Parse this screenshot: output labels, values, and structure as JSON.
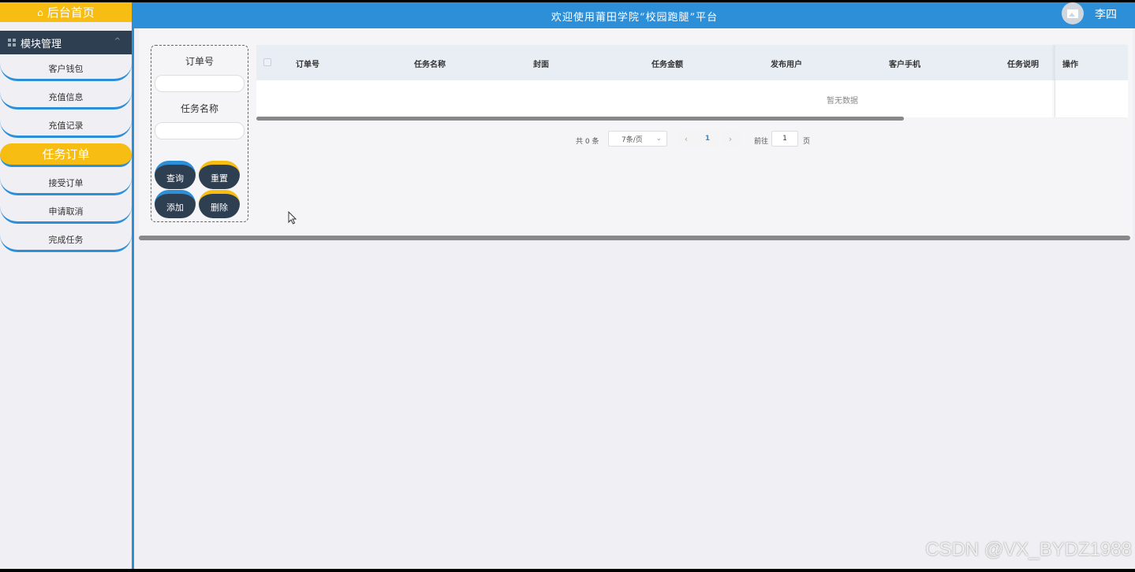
{
  "sidebar": {
    "home_label": "后台首页",
    "module_label": "模块管理",
    "items": [
      {
        "label": "客户钱包"
      },
      {
        "label": "充值信息"
      },
      {
        "label": "充值记录"
      },
      {
        "label": "任务订单"
      },
      {
        "label": "接受订单"
      },
      {
        "label": "申请取消"
      },
      {
        "label": "完成任务"
      }
    ],
    "active_index": 3
  },
  "header": {
    "title": "欢迎使用莆田学院“校园跑腿”平台",
    "username": "李四"
  },
  "search": {
    "order_label": "订单号",
    "task_label": "任务名称",
    "buttons": {
      "query": "查询",
      "reset": "重置",
      "add": "添加",
      "delete": "删除"
    }
  },
  "table": {
    "columns": [
      "订单号",
      "任务名称",
      "封面",
      "任务金额",
      "发布用户",
      "客户手机",
      "任务说明",
      "操作"
    ],
    "empty_text": "暂无数据"
  },
  "pagination": {
    "total_text": "共 0 条",
    "page_size": "7条/页",
    "current_page": "1",
    "goto_label": "前往",
    "goto_value": "1",
    "page_unit": "页"
  },
  "watermark": "CSDN @VX_BYDZ1988",
  "colors": {
    "accent_blue": "#2d8fd8",
    "accent_yellow": "#f7bd13",
    "dark_navy": "#2e3f52"
  }
}
